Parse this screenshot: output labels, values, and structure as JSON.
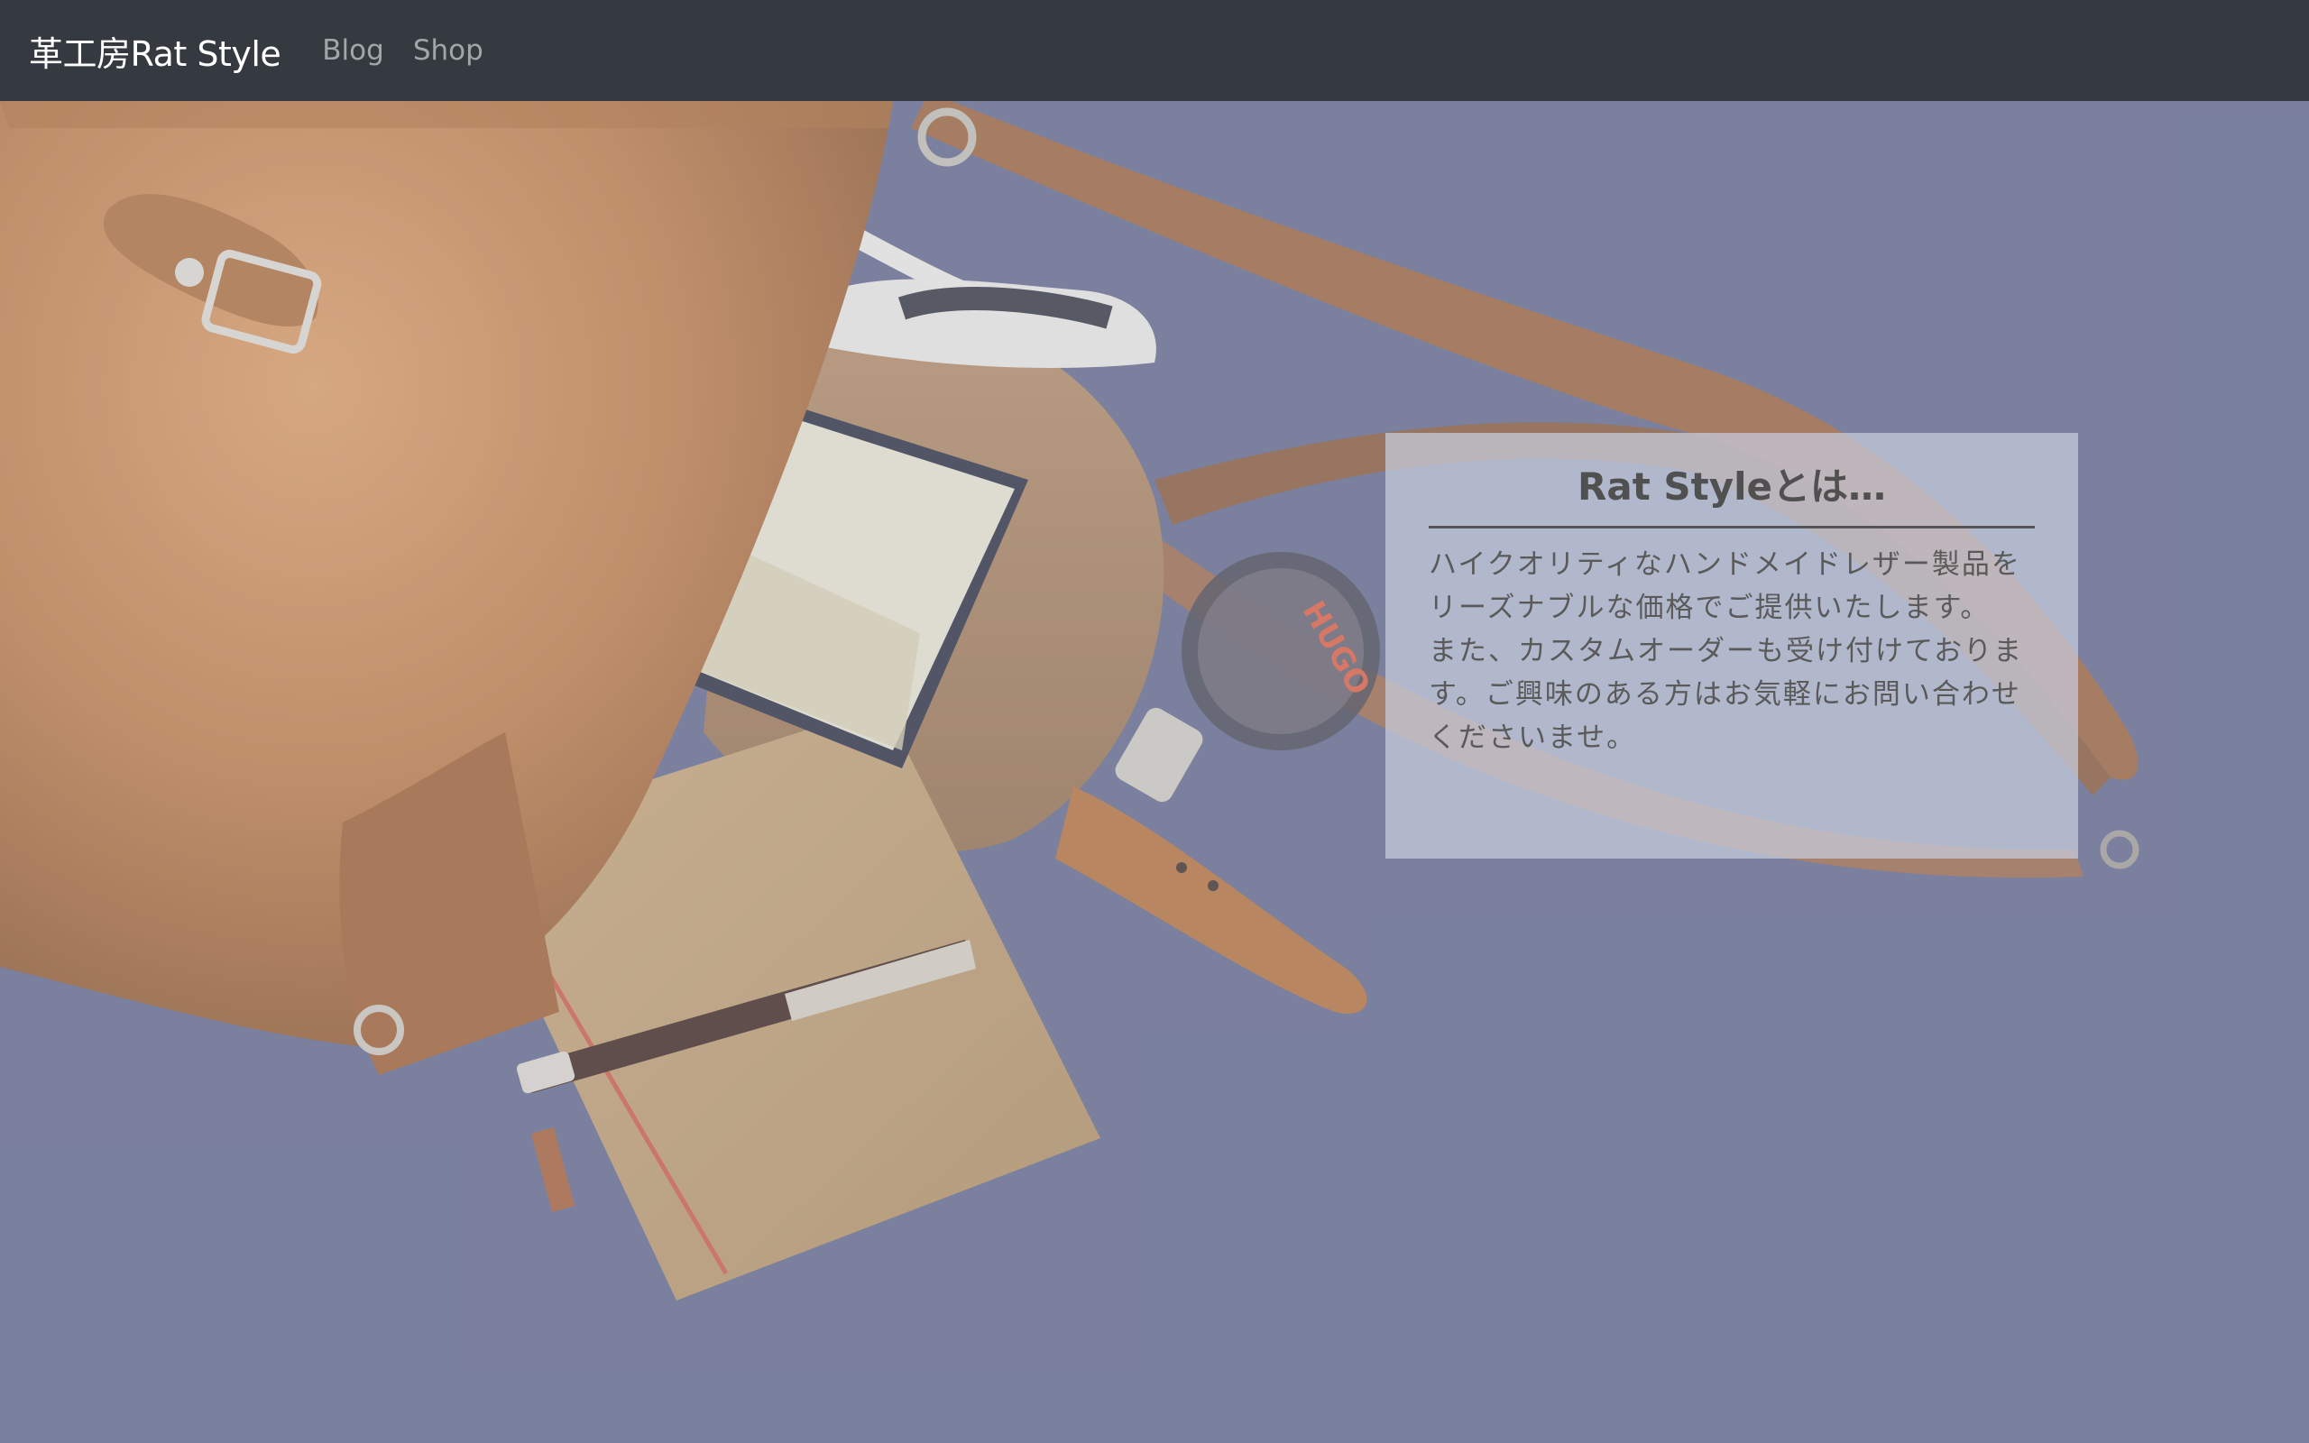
{
  "navbar": {
    "brand": "革工房Rat Style",
    "links": [
      {
        "label": "Blog"
      },
      {
        "label": "Shop"
      }
    ]
  },
  "hero": {
    "image_description_icon": "leather-bag-photo"
  },
  "card": {
    "title": "Rat Styleとは…",
    "paragraph_1": "ハイクオリティなハンドメイドレザー製品をリーズナブルな価格でご提供いたします。",
    "paragraph_2": "また、カスタムオーダーも受け付けております。ご興味のある方はお気軽にお問い合わせくださいませ。"
  },
  "colors": {
    "navbar_bg": "#343a40",
    "background": "#5c6385",
    "leather": "#b9773f",
    "card_bg": "#c8cdde"
  }
}
